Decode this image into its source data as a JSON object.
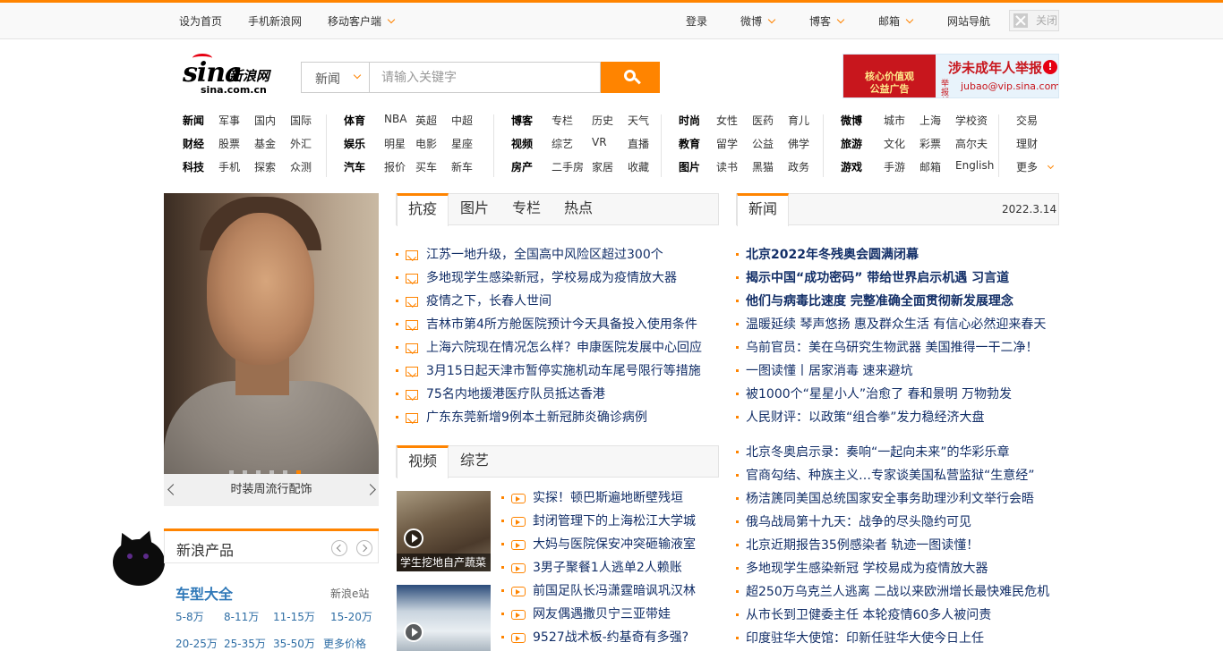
{
  "topbar": {
    "set_home": "设为首页",
    "mobile_sina": "手机新浪网",
    "mobile_client": "移动客户端",
    "login": "登录",
    "weibo": "微博",
    "blog": "博客",
    "mail": "邮箱",
    "site_nav": "网站导航",
    "close": "关闭"
  },
  "logo": {
    "brand": "sina",
    "cn": "新浪网",
    "domain": "sina.com.cn"
  },
  "search": {
    "category": "新闻",
    "placeholder": "请输入关键字"
  },
  "ad": {
    "left_line1": "核心价值观",
    "left_line2": "公益广告",
    "title": "涉未成年人举报",
    "side": "举报邮箱",
    "email": "jubao@vip.sina.com"
  },
  "nav": {
    "groups": [
      [
        [
          "新闻",
          "军事",
          "国内",
          "国际"
        ],
        [
          "财经",
          "股票",
          "基金",
          "外汇"
        ],
        [
          "科技",
          "手机",
          "探索",
          "众测"
        ]
      ],
      [
        [
          "体育",
          "NBA",
          "英超",
          "中超"
        ],
        [
          "娱乐",
          "明星",
          "电影",
          "星座"
        ],
        [
          "汽车",
          "报价",
          "买车",
          "新车"
        ]
      ],
      [
        [
          "博客",
          "专栏",
          "历史",
          "天气"
        ],
        [
          "视频",
          "综艺",
          "VR",
          "直播"
        ],
        [
          "房产",
          "二手房",
          "家居",
          "收藏"
        ]
      ],
      [
        [
          "时尚",
          "女性",
          "医药",
          "育儿"
        ],
        [
          "教育",
          "留学",
          "公益",
          "佛学"
        ],
        [
          "图片",
          "读书",
          "黑猫",
          "政务"
        ]
      ],
      [
        [
          "微博",
          "城市",
          "上海",
          "学校资"
        ],
        [
          "旅游",
          "文化",
          "彩票",
          "高尔夫"
        ],
        [
          "游戏",
          "手游",
          "邮箱",
          "English"
        ]
      ],
      [
        [
          "交易"
        ],
        [
          "理财"
        ],
        [
          "更多"
        ]
      ]
    ]
  },
  "hero": {
    "caption": "时装周流行配饰",
    "slides": 6,
    "active": 6
  },
  "products": {
    "title": "新浪产品",
    "subtitle": "车型大全",
    "estation": "新浪e站",
    "links": [
      "5-8万",
      "8-11万",
      "11-15万",
      "15-20万",
      "20-25万",
      "25-35万",
      "35-50万",
      "更多价格"
    ]
  },
  "tabs_mid": [
    "抗疫",
    "图片",
    "专栏",
    "热点"
  ],
  "tabs_video": [
    "视频",
    "综艺"
  ],
  "tabs_news": {
    "label": "新闻",
    "date": "2022.3.14"
  },
  "antiepidemic": [
    "江苏一地升级，全国高中风险区超过300个",
    "多地现学生感染新冠，学校易成为疫情放大器",
    "疫情之下，长春人世间",
    "吉林市第4所方舱医院预计今天具备投入使用条件",
    "上海六院现在情况怎么样？申康医院发展中心回应",
    "3月15日起天津市暂停实施机动车尾号限行等措施",
    "75名内地援港医疗队员抵达香港",
    "广东东莞新增9例本土新冠肺炎确诊病例"
  ],
  "videos": {
    "thumb1_caption": "学生挖地自产蔬菜",
    "items": [
      "实探！顿巴斯遍地断壁残垣",
      "封闭管理下的上海松江大学城",
      "大妈与医院保安冲突砸输液室",
      "3男子聚餐1人逃单2人赖账",
      "前国足队长冯潇霆暗讽巩汉林",
      "网友偶遇撒贝宁三亚带娃",
      "9527战术板-约基奇有多强?"
    ]
  },
  "news_top": [
    "北京2022年冬残奥会圆满闭幕",
    "揭示中国“成功密码” 带给世界启示机遇 习言道",
    "他们与病毒比速度 完整准确全面贯彻新发展理念",
    "温暖延续 琴声悠扬 惠及群众生活 有信心必然迎来春天",
    "乌前官员：美在乌研究生物武器 美国推得一干二净！",
    "一图读懂丨居家消毒 速来避坑",
    "被1000个“星星小人”治愈了 春和景明 万物勃发",
    "人民财评：以政策“组合拳”发力稳经济大盘"
  ],
  "news_bottom": [
    "北京冬奥启示录：奏响“一起向未来”的华彩乐章",
    "官商勾结、种族主义…专家谈美国私营监狱“生意经”",
    "杨洁篪同美国总统国家安全事务助理沙利文举行会晤",
    "俄乌战局第十九天：战争的尽头隐约可见",
    "北京近期报告35例感染者 轨迹一图读懂！",
    "多地现学生感染新冠 学校易成为疫情放大器",
    "超250万乌克兰人逃离 二战以来欧洲增长最快难民危机",
    "从市长到卫健委主任 本轮疫情60多人被问责",
    "印度驻华大使馆：印新任驻华大使今日上任"
  ],
  "colors": {
    "accent": "#ff8400",
    "link": "#122e67"
  }
}
